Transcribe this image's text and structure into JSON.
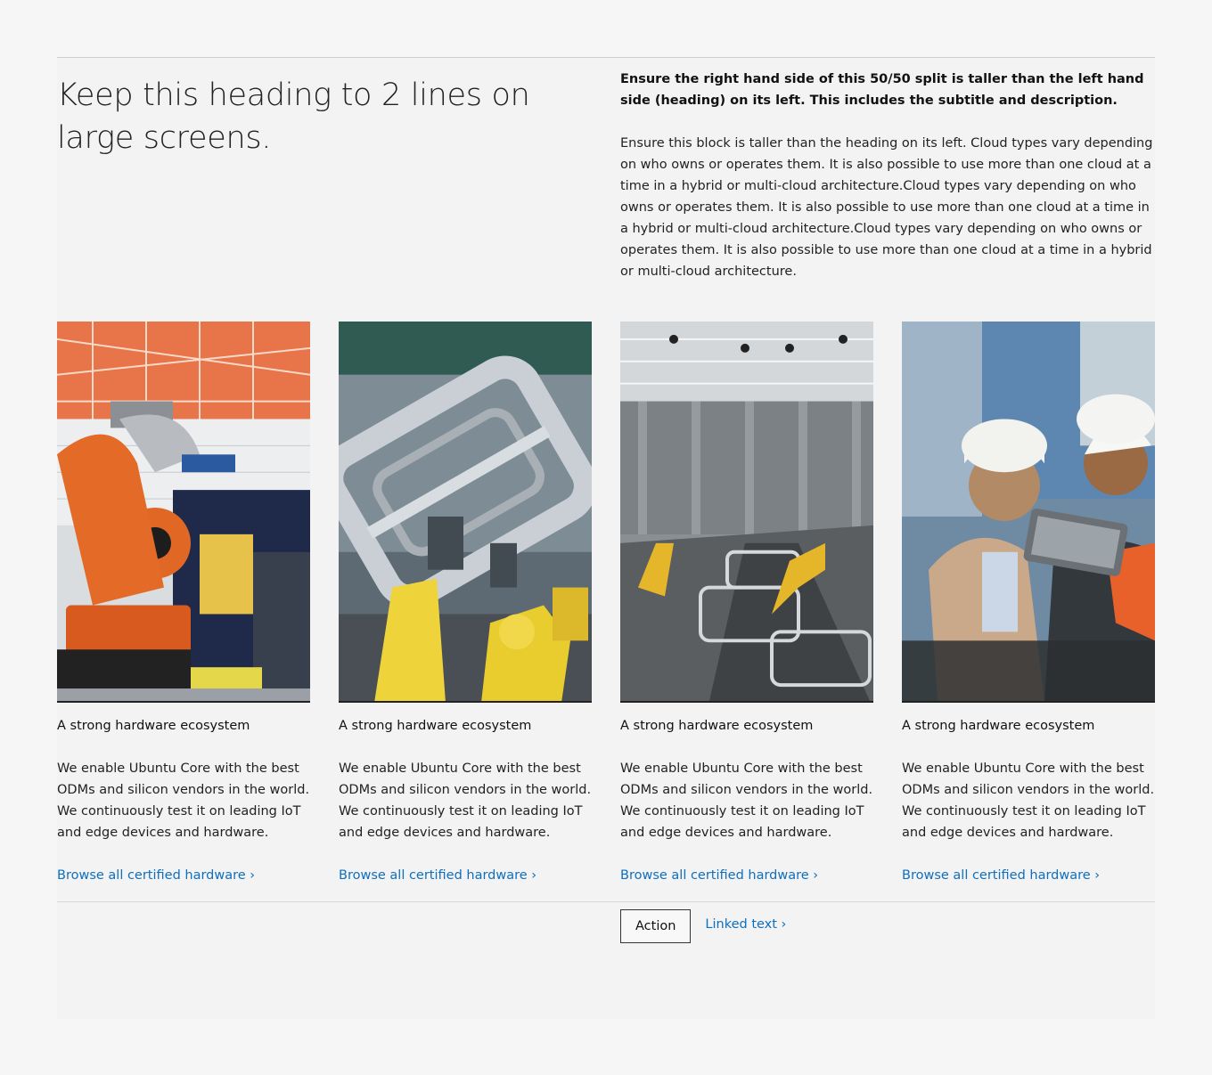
{
  "section": {
    "heading": "Keep this heading to 2 lines on large screens.",
    "subtitle": "Ensure the right hand side of this 50/50 split is taller than the left hand side (heading) on its left. This includes the subtitle and description.",
    "description": "Ensure this block is taller than the heading on its left. Cloud types vary depending on who owns or operates them. It is also possible to use more than one cloud at a time in a hybrid or multi-cloud architecture.Cloud types vary depending on who owns or operates them. It is also possible to use more than one cloud at a time in a hybrid or multi-cloud architecture.Cloud types vary depending on who owns or operates them. It is also possible to use more than one cloud at a time in a hybrid or multi-cloud architecture."
  },
  "cards": [
    {
      "image": "orange-industrial-robot-arm-photo",
      "title": "A strong hardware ecosystem",
      "text": "We enable Ubuntu Core with the best ODMs and silicon vendors in the world. We continuously test it on leading IoT and edge devices and hardware.",
      "link": "Browse all certified hardware ›"
    },
    {
      "image": "car-body-assembly-robots-photo",
      "title": "A strong hardware ecosystem",
      "text": "We enable Ubuntu Core with the best ODMs and silicon vendors in the world. We continuously test it on leading IoT and edge devices and hardware.",
      "link": "Browse all certified hardware ›"
    },
    {
      "image": "automotive-factory-line-photo",
      "title": "A strong hardware ecosystem",
      "text": "We enable Ubuntu Core with the best ODMs and silicon vendors in the world. We continuously test it on leading IoT and edge devices and hardware.",
      "link": "Browse all certified hardware ›"
    },
    {
      "image": "engineers-with-tablet-photo",
      "title": "A strong hardware ecosystem",
      "text": "We enable Ubuntu Core with the best ODMs and silicon vendors in the world. We continuously test it on leading IoT and edge devices and hardware.",
      "link": "Browse all certified hardware ›"
    }
  ],
  "footer": {
    "action_label": "Action",
    "linked_text": "Linked text ›"
  },
  "colors": {
    "link": "#0e6fbf",
    "background": "#f3f3f3"
  }
}
